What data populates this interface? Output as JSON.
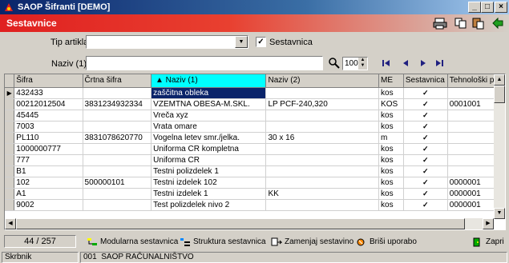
{
  "window": {
    "title": "SAOP Šifranti [DEMO]",
    "min": "_",
    "max": "□",
    "close": "×"
  },
  "header": {
    "title": "Sestavnice"
  },
  "filters": {
    "tip_label": "Tip artikla",
    "tip_value": "",
    "sestavnica_label": "Sestavnica",
    "sestavnica_checked": "✓",
    "naziv_label": "Naziv (1)",
    "naziv_value": "",
    "limit": "100"
  },
  "grid": {
    "columns": [
      "Šifra",
      "Črtna šifra",
      "Naziv (1)",
      "Naziv (2)",
      "ME",
      "Sestavnica",
      "Tehnološki pos"
    ],
    "sorted_marker": "▲",
    "rows": [
      [
        "432433",
        "",
        "zaščitna obleka",
        "",
        "kos",
        "✓",
        ""
      ],
      [
        "00212012504",
        "3831234932334",
        "VZEMTNA OBESA-M.SKL.",
        "LP PCF-240,320",
        "KOS",
        "✓",
        "0001001"
      ],
      [
        "45445",
        "",
        "Vreča xyz",
        "",
        "kos",
        "✓",
        ""
      ],
      [
        "7003",
        "",
        "Vrata omare",
        "",
        "kos",
        "✓",
        ""
      ],
      [
        "PL110",
        "3831078620770",
        "Vogelna letev smr./jelka.",
        "30 x 16",
        "m",
        "✓",
        ""
      ],
      [
        "1000000777",
        "",
        "Uniforma CR kompletna",
        "",
        "kos",
        "✓",
        ""
      ],
      [
        "777",
        "",
        "Uniforma CR",
        "",
        "kos",
        "✓",
        ""
      ],
      [
        "B1",
        "",
        "Testni polizdelek 1",
        "",
        "kos",
        "✓",
        ""
      ],
      [
        "102",
        "500000101",
        "Testni izdelek 102",
        "",
        "kos",
        "✓",
        "0000001"
      ],
      [
        "A1",
        "",
        "Testni izdelek 1",
        "KK",
        "kos",
        "✓",
        "0000001"
      ],
      [
        "9002",
        "",
        "Test polizdelek nivo 2",
        "",
        "kos",
        "✓",
        "0000001"
      ]
    ]
  },
  "footer": {
    "counter": "44 / 257",
    "buttons": [
      "Modularna sestavnica",
      "Struktura sestavnica",
      "Zamenjaj sestavino",
      "Briši uporabo",
      "Zapri"
    ]
  },
  "status": {
    "user": "Skrbnik",
    "code": "001",
    "company": "SAOP RAČUNALNIŠTVO"
  },
  "colors": {
    "header_red": "#e02020",
    "title_blue": "#0a246a",
    "sorted_header": "#00ffff"
  }
}
